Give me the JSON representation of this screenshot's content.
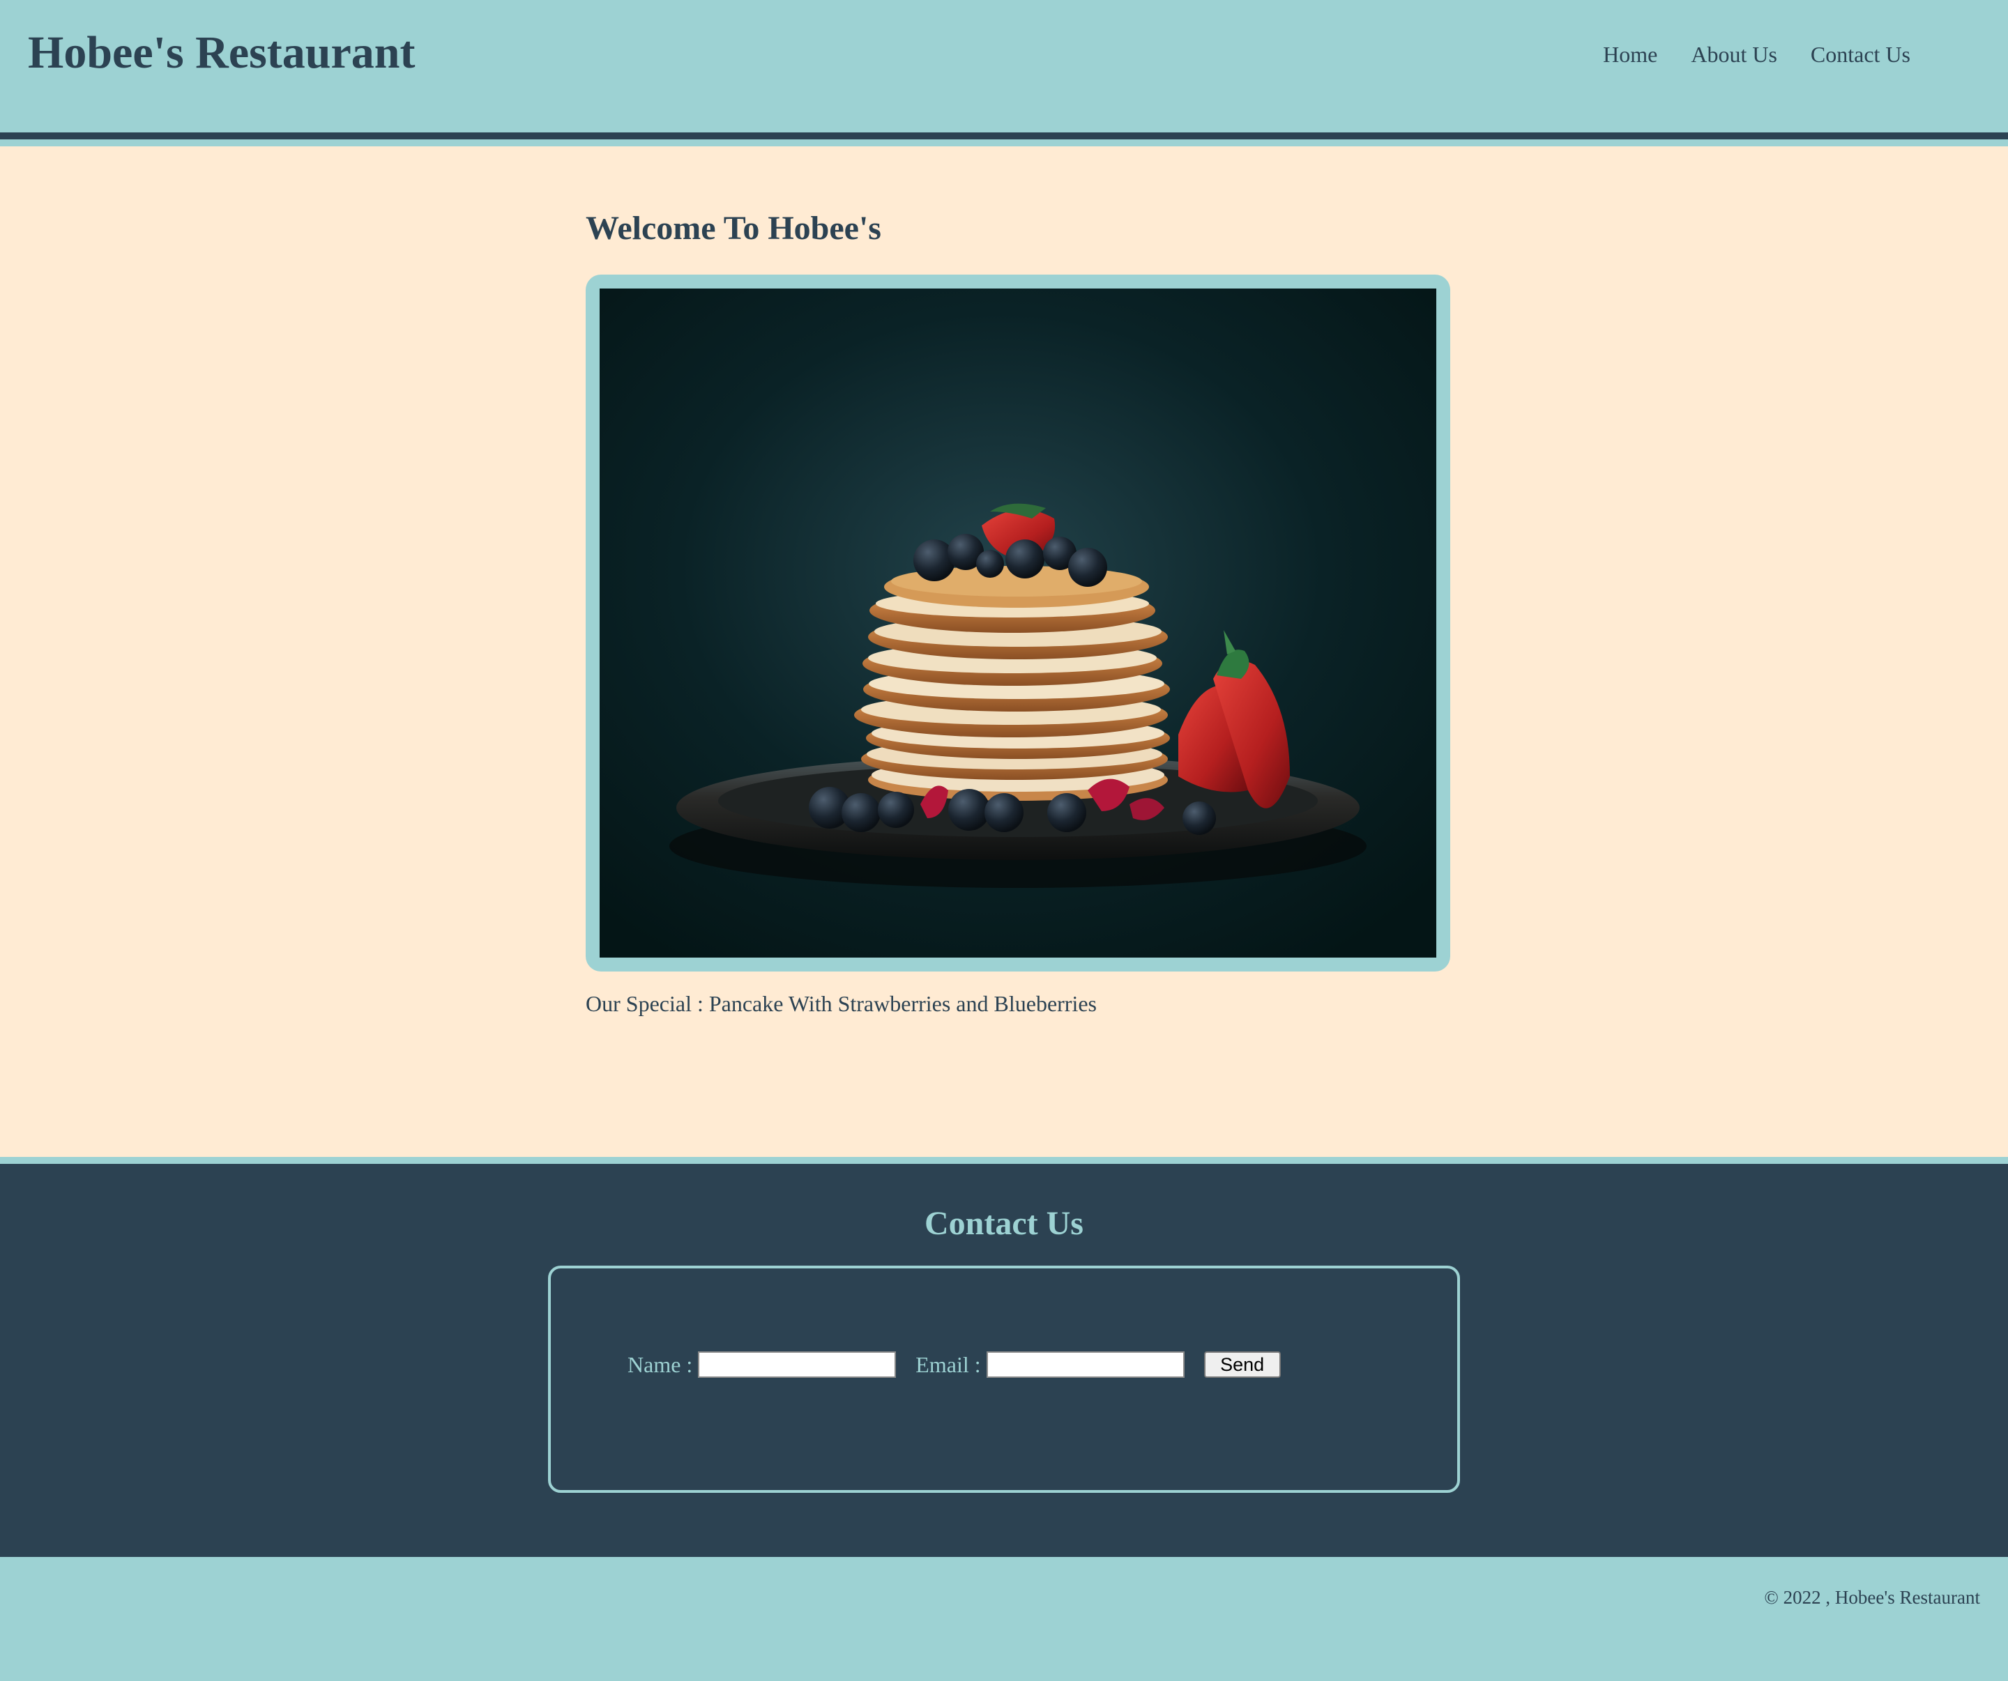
{
  "header": {
    "title": "Hobee's Restaurant",
    "nav": [
      {
        "label": "Home"
      },
      {
        "label": "About Us"
      },
      {
        "label": "Contact Us"
      }
    ]
  },
  "main": {
    "heading": "Welcome To Hobee's",
    "image_subject": "stack of pancakes with strawberries and blueberries on a plate",
    "caption": "Our Special : Pancake With Strawberries and Blueberries"
  },
  "contact": {
    "heading": "Contact Us",
    "name_label": "Name :",
    "name_value": "",
    "email_label": "Email :",
    "email_value": "",
    "send_label": "Send"
  },
  "footer": {
    "copyright": "© 2022 , Hobee's Restaurant"
  },
  "colors": {
    "teal": "#9dd2d3",
    "navy": "#2c4252",
    "cream": "#ffebd3"
  }
}
